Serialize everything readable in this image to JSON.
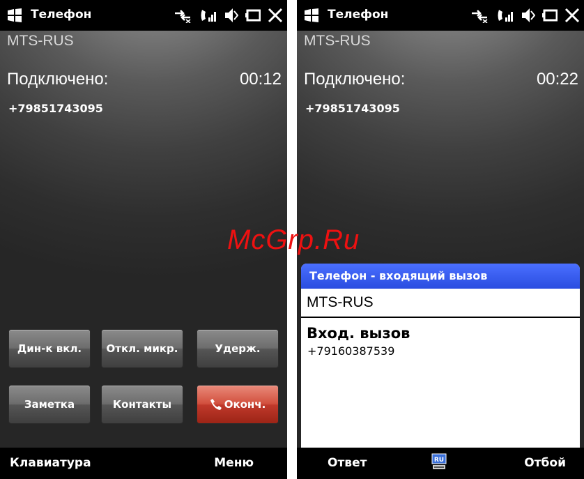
{
  "left": {
    "status_title": "Телефон",
    "carrier": "MTS-RUS",
    "call_state": "Подключено:",
    "timer": "00:12",
    "number": "+79851743095",
    "buttons": {
      "speaker": "Дин-к вкл.",
      "mute": "Откл. микр.",
      "hold": "Удерж.",
      "note": "Заметка",
      "contacts": "Контакты",
      "end": "Оконч."
    },
    "softkeys": {
      "left": "Клавиатура",
      "right": "Меню"
    }
  },
  "right": {
    "status_title": "Телефон",
    "carrier": "MTS-RUS",
    "call_state": "Подключено:",
    "timer": "00:22",
    "number": "+79851743095",
    "dialog": {
      "title": "Телефон - входящий вызов",
      "carrier": "MTS-RUS",
      "heading": "Вход. вызов",
      "number": "+79160387539"
    },
    "softkeys": {
      "left": "Ответ",
      "center": "RU",
      "right": "Отбой"
    }
  },
  "watermark": "McGrp.Ru",
  "colors": {
    "end_button": "#c0392b",
    "dialog_title": "#2a4de0",
    "watermark": "#ee1111"
  },
  "icons": [
    "windows-logo-icon",
    "data-connection-icon",
    "signal-icon",
    "speaker-muted-icon",
    "battery-icon",
    "close-icon",
    "phone-icon",
    "keyboard-icon"
  ]
}
